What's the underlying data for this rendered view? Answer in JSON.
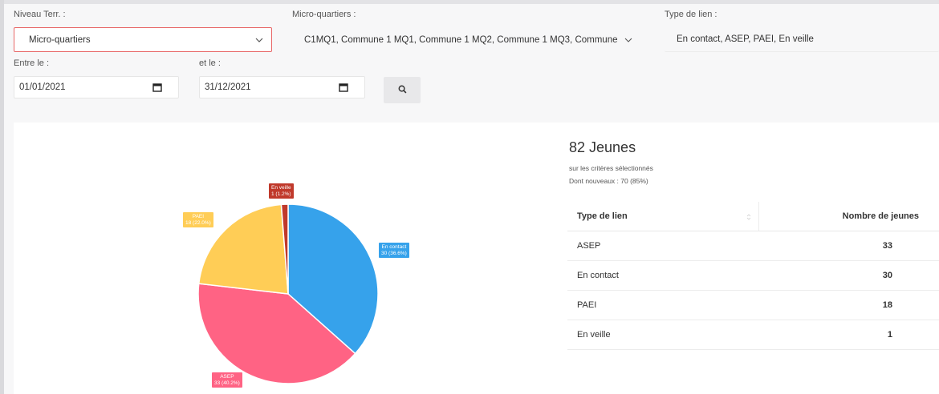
{
  "filters": {
    "niveau_label": "Niveau Terr. :",
    "niveau_value": "Micro-quartiers",
    "microq_label": "Micro-quartiers :",
    "microq_value": "C1MQ1, Commune 1 MQ1, Commune 1 MQ2, Commune 1 MQ3, Commune",
    "type_label": "Type de lien :",
    "type_value": "En contact, ASEP, PAEI, En veille",
    "entre_label": "Entre le :",
    "entre_value": "01/01/2021",
    "et_label": "et le :",
    "et_value": "31/12/2021",
    "search_icon": "search-icon",
    "calendar_icon": "calendar-icon",
    "chevron_icon": "chevron-down-icon"
  },
  "summary": {
    "total": "82 Jeunes",
    "criteria": "sur les critères sélectionnés",
    "nouveaux": "Dont nouveaux : 70 (85%)"
  },
  "table": {
    "headers": [
      "Type de lien",
      "Nombre de jeunes"
    ],
    "rows": [
      {
        "type": "ASEP",
        "count": "33"
      },
      {
        "type": "En contact",
        "count": "30"
      },
      {
        "type": "PAEI",
        "count": "18"
      },
      {
        "type": "En veille",
        "count": "1"
      }
    ]
  },
  "chart_data": {
    "type": "pie",
    "slices": [
      {
        "name": "En contact",
        "value": 30,
        "label": "En contact",
        "pct_label": "30 (36.6%)",
        "color": "#36a2eb"
      },
      {
        "name": "ASEP",
        "value": 33,
        "label": "ASEP",
        "pct_label": "33 (40.2%)",
        "color": "#ff6384"
      },
      {
        "name": "PAEI",
        "value": 18,
        "label": "PAEI",
        "pct_label": "18 (22.0%)",
        "color": "#ffcd56"
      },
      {
        "name": "En veille",
        "value": 1,
        "label": "En veille",
        "pct_label": "1 (1.2%)",
        "color": "#c0392b"
      }
    ],
    "start": "top",
    "direction": "clockwise"
  }
}
